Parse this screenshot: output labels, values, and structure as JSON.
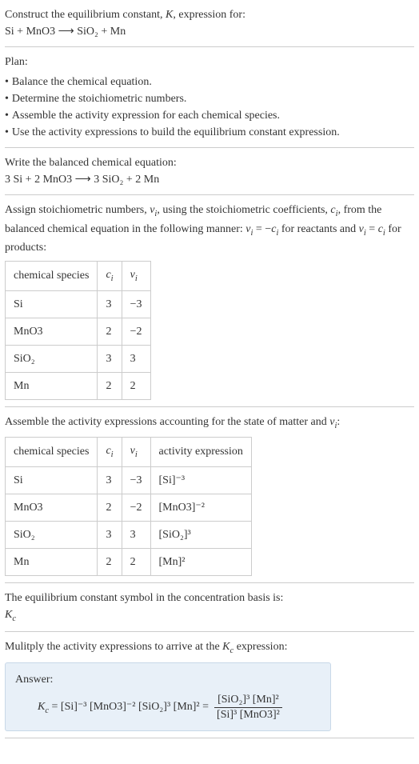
{
  "intro": {
    "line1": "Construct the equilibrium constant, K, expression for:",
    "equation": "Si + MnO3 ⟶ SiO₂ + Mn"
  },
  "plan": {
    "title": "Plan:",
    "items": [
      "Balance the chemical equation.",
      "Determine the stoichiometric numbers.",
      "Assemble the activity expression for each chemical species.",
      "Use the activity expressions to build the equilibrium constant expression."
    ]
  },
  "balanced": {
    "title": "Write the balanced chemical equation:",
    "equation": "3 Si + 2 MnO3 ⟶ 3 SiO₂ + 2 Mn"
  },
  "stoich": {
    "intro_a": "Assign stoichiometric numbers, ",
    "nu": "ν",
    "i": "i",
    "intro_b": ", using the stoichiometric coefficients, ",
    "c": "c",
    "intro_c": ", from the balanced chemical equation in the following manner: ",
    "rel1_a": "ν",
    "rel1_b": " = −",
    "rel1_c": "c",
    "intro_d": " for reactants and ",
    "rel2_a": "ν",
    "rel2_b": " = ",
    "rel2_c": "c",
    "intro_e": " for products:",
    "headers": [
      "chemical species",
      "cᵢ",
      "νᵢ"
    ],
    "rows": [
      {
        "species": "Si",
        "c": "3",
        "nu": "−3"
      },
      {
        "species": "MnO3",
        "c": "2",
        "nu": "−2"
      },
      {
        "species": "SiO₂",
        "c": "3",
        "nu": "3"
      },
      {
        "species": "Mn",
        "c": "2",
        "nu": "2"
      }
    ]
  },
  "activity": {
    "intro": "Assemble the activity expressions accounting for the state of matter and νᵢ:",
    "headers": [
      "chemical species",
      "cᵢ",
      "νᵢ",
      "activity expression"
    ],
    "rows": [
      {
        "species": "Si",
        "c": "3",
        "nu": "−3",
        "expr": "[Si]⁻³"
      },
      {
        "species": "MnO3",
        "c": "2",
        "nu": "−2",
        "expr": "[MnO3]⁻²"
      },
      {
        "species": "SiO₂",
        "c": "3",
        "nu": "3",
        "expr": "[SiO₂]³"
      },
      {
        "species": "Mn",
        "c": "2",
        "nu": "2",
        "expr": "[Mn]²"
      }
    ]
  },
  "symbol": {
    "line1": "The equilibrium constant symbol in the concentration basis is:",
    "line2": "K",
    "line2sub": "c"
  },
  "multiply": {
    "intro_a": "Mulitply the activity expressions to arrive at the ",
    "kc": "K",
    "kcsub": "c",
    "intro_b": " expression:"
  },
  "answer": {
    "label": "Answer:",
    "k": "K",
    "ksub": "c",
    "eq": " = [Si]⁻³ [MnO3]⁻² [SiO₂]³ [Mn]² = ",
    "frac_num": "[SiO₂]³ [Mn]²",
    "frac_den": "[Si]³ [MnO3]²"
  }
}
